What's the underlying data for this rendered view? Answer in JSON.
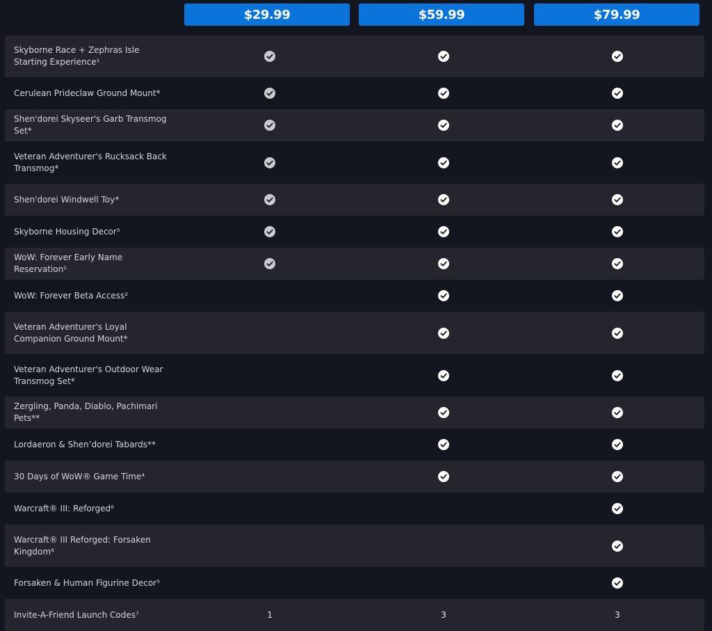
{
  "tiers": [
    {
      "price": "$29.99"
    },
    {
      "price": "$59.99"
    },
    {
      "price": "$79.99"
    }
  ],
  "colors": {
    "page_bg": "#14161f",
    "row_alt_bg": "#25262d",
    "price_button_bg": "#0a74da",
    "check_included_base": "#c9cbd0",
    "check_included_premium": "#ffffff"
  },
  "icons": {
    "check": "check-circle-icon"
  },
  "features": [
    {
      "label": "Skyborne Race + Zephras Isle Starting Experience¹",
      "cells": [
        {
          "type": "check",
          "style": "grey"
        },
        {
          "type": "check",
          "style": "white"
        },
        {
          "type": "check",
          "style": "white"
        }
      ]
    },
    {
      "label": "Cerulean Prideclaw Ground Mount*",
      "cells": [
        {
          "type": "check",
          "style": "grey"
        },
        {
          "type": "check",
          "style": "white"
        },
        {
          "type": "check",
          "style": "white"
        }
      ]
    },
    {
      "label": "Shen'dorei Skyseer's Garb Transmog Set*",
      "cells": [
        {
          "type": "check",
          "style": "grey"
        },
        {
          "type": "check",
          "style": "white"
        },
        {
          "type": "check",
          "style": "white"
        }
      ]
    },
    {
      "label": "Veteran Adventurer's Rucksack Back Transmog*",
      "cells": [
        {
          "type": "check",
          "style": "grey"
        },
        {
          "type": "check",
          "style": "white"
        },
        {
          "type": "check",
          "style": "white"
        }
      ]
    },
    {
      "label": "Shen'dorei Windwell Toy*",
      "cells": [
        {
          "type": "check",
          "style": "grey"
        },
        {
          "type": "check",
          "style": "white"
        },
        {
          "type": "check",
          "style": "white"
        }
      ]
    },
    {
      "label": "Skyborne Housing Decor⁵",
      "cells": [
        {
          "type": "check",
          "style": "grey"
        },
        {
          "type": "check",
          "style": "white"
        },
        {
          "type": "check",
          "style": "white"
        }
      ]
    },
    {
      "label": "WoW: Forever Early Name Reservation¹",
      "cells": [
        {
          "type": "check",
          "style": "grey"
        },
        {
          "type": "check",
          "style": "white"
        },
        {
          "type": "check",
          "style": "white"
        }
      ]
    },
    {
      "label": "WoW: Forever Beta Access²",
      "cells": [
        {
          "type": "empty"
        },
        {
          "type": "check",
          "style": "white"
        },
        {
          "type": "check",
          "style": "white"
        }
      ]
    },
    {
      "label": "Veteran Adventurer's Loyal Companion Ground Mount*",
      "cells": [
        {
          "type": "empty"
        },
        {
          "type": "check",
          "style": "white"
        },
        {
          "type": "check",
          "style": "white"
        }
      ]
    },
    {
      "label": "Veteran Adventurer's Outdoor Wear Transmog Set*",
      "cells": [
        {
          "type": "empty"
        },
        {
          "type": "check",
          "style": "white"
        },
        {
          "type": "check",
          "style": "white"
        }
      ]
    },
    {
      "label": "Zergling, Panda, Diablo, Pachimari Pets**",
      "cells": [
        {
          "type": "empty"
        },
        {
          "type": "check",
          "style": "white"
        },
        {
          "type": "check",
          "style": "white"
        }
      ]
    },
    {
      "label": "Lordaeron & Shen’dorei Tabards**",
      "cells": [
        {
          "type": "empty"
        },
        {
          "type": "check",
          "style": "white"
        },
        {
          "type": "check",
          "style": "white"
        }
      ]
    },
    {
      "label": "30 Days of WoW® Game Time⁴",
      "cells": [
        {
          "type": "empty"
        },
        {
          "type": "check",
          "style": "white"
        },
        {
          "type": "check",
          "style": "white"
        }
      ]
    },
    {
      "label": "Warcraft® III: Reforged⁶",
      "cells": [
        {
          "type": "empty"
        },
        {
          "type": "empty"
        },
        {
          "type": "check",
          "style": "white"
        }
      ]
    },
    {
      "label": "Warcraft® III Reforged: Forsaken Kingdom⁶",
      "cells": [
        {
          "type": "empty"
        },
        {
          "type": "empty"
        },
        {
          "type": "check",
          "style": "white"
        }
      ]
    },
    {
      "label": "Forsaken & Human Figurine Decor⁵",
      "cells": [
        {
          "type": "empty"
        },
        {
          "type": "empty"
        },
        {
          "type": "check",
          "style": "white"
        }
      ]
    },
    {
      "label": "Invite-A-Friend Launch Codes⁷",
      "cells": [
        {
          "type": "text",
          "value": "1"
        },
        {
          "type": "text",
          "value": "3"
        },
        {
          "type": "text",
          "value": "3"
        }
      ]
    }
  ]
}
